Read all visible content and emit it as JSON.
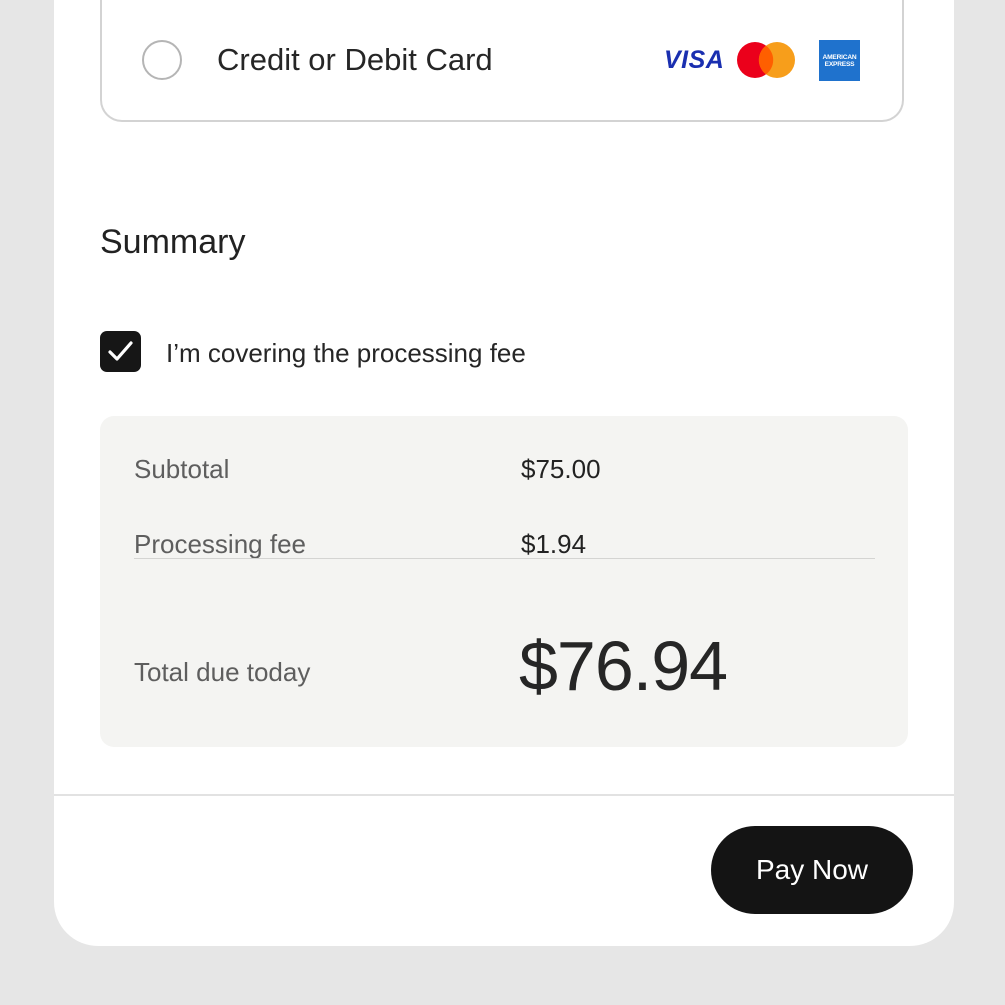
{
  "payment_method": {
    "label": "Credit or Debit Card",
    "selected": false,
    "card_brands": {
      "visa_text": "VISA",
      "mastercard_icon": "mastercard-logo",
      "amex_text": "AMERICAN EXPRESS"
    }
  },
  "summary": {
    "title": "Summary",
    "cover_fee_label": "I’m covering the processing fee",
    "cover_fee_checked": true,
    "rows": [
      {
        "label": "Subtotal",
        "value": "$75.00"
      },
      {
        "label": "Processing fee",
        "value": "$1.94"
      }
    ],
    "total_label": "Total due today",
    "total_value": "$76.94"
  },
  "footer": {
    "pay_button_label": "Pay Now"
  },
  "colors": {
    "background": "#e6e6e6",
    "panel": "#ffffff",
    "summary_box": "#f4f4f2",
    "button": "#141414",
    "visa_blue": "#1a2fb0",
    "amex_blue": "#1f72cd",
    "mastercard_red": "#eb001b",
    "mastercard_orange": "#f79e1b"
  }
}
